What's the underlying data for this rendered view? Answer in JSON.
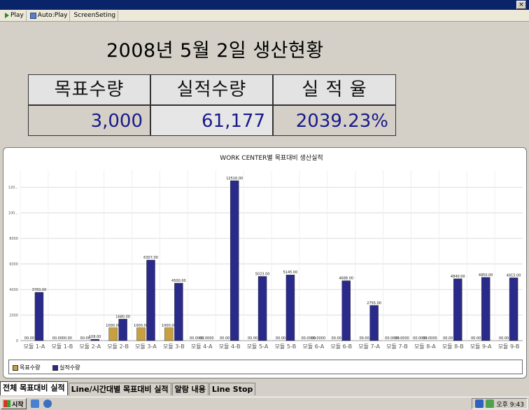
{
  "toolbar": {
    "items": [
      {
        "label": "Play",
        "icon": "play-icon"
      },
      {
        "label": "Auto:Play",
        "icon": "autoplay-icon"
      },
      {
        "label": "ScreenSeting",
        "icon": ""
      }
    ]
  },
  "header": {
    "title": "2008년 5월 2일 생산현황"
  },
  "kpi": [
    {
      "label": "목표수량",
      "value": "3,000"
    },
    {
      "label": "실적수량",
      "value": "61,177"
    },
    {
      "label": "실 적 율",
      "value": "2039.23%"
    }
  ],
  "chart_data": {
    "type": "bar",
    "title": "WORK CENTER별 목표대비 생산실적",
    "categories": [
      "모듈 1-A",
      "모듈 1-B",
      "모듈 2-A",
      "모듈 2-B",
      "모듈 3-A",
      "모듈 3-B",
      "모듈 4-A",
      "모듈 4-B",
      "모듈 5-A",
      "모듈 5-B",
      "모듈 6-A",
      "모듈 6-B",
      "모듈 7-A",
      "모듈 7-B",
      "모듈 8-A",
      "모듈 8-B",
      "모듈 9-A",
      "모듈 9-B"
    ],
    "series": [
      {
        "name": "목표수량",
        "color": "#c8a040",
        "values": [
          0,
          0,
          0,
          1000,
          1000,
          1000,
          0,
          0,
          0,
          0,
          0,
          0,
          0,
          0,
          0,
          0,
          0,
          0
        ],
        "labels": [
          "00.00",
          "00.00",
          "00.00",
          "1000.00",
          "1000.00",
          "1000.00",
          "00.0000",
          "00.00",
          "00.00",
          "00.00",
          "00.0000",
          "00.00",
          "00.00",
          "00.0000",
          "00.0000",
          "00.00",
          "00.00",
          "00.00"
        ]
      },
      {
        "name": "실적수량",
        "color": "#2a2a8a",
        "values": [
          3783,
          0,
          108,
          1680,
          6307,
          4500,
          0,
          12516,
          5023,
          5145,
          0,
          4688,
          2755,
          0,
          0,
          4840,
          4950,
          4915
        ],
        "labels": [
          "3783.00",
          "00.00",
          "108.00",
          "1680.00",
          "6307.00",
          "4500.00",
          "00.0000",
          "12516.00",
          "5023.00",
          "5145.00",
          "00.0000",
          "4688.00",
          "2755.00",
          "00.0000",
          "00.0000",
          "4840.00",
          "4950.00",
          "4915.00"
        ]
      }
    ],
    "y_ticks": [
      "0",
      "2000",
      "4000",
      "6000",
      "8000",
      "100...",
      "120..."
    ],
    "ylim": [
      0,
      13000
    ],
    "grid": true,
    "legend": "bottom"
  },
  "tabs": [
    {
      "label": "전체 목표대비 실적",
      "active": true
    },
    {
      "label": "Line/시간대별 목표대비 실적",
      "active": false
    },
    {
      "label": "알람 내용",
      "active": false
    },
    {
      "label": "Line Stop",
      "active": false
    }
  ],
  "taskbar": {
    "start_label": "시작",
    "clock": "오후 9:43"
  }
}
